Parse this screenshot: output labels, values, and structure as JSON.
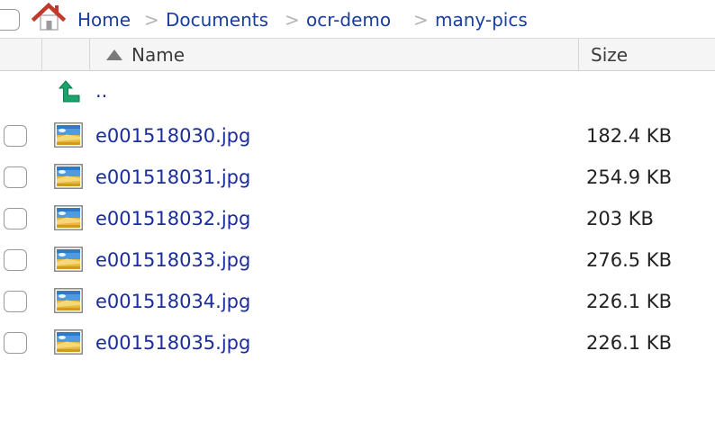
{
  "breadcrumb": {
    "items": [
      {
        "label": "Home",
        "icon": "home-icon"
      },
      {
        "label": "Documents"
      },
      {
        "label": "ocr-demo"
      },
      {
        "label": "many-pics"
      }
    ],
    "separator": ">"
  },
  "table": {
    "columns": {
      "name": {
        "label": "Name",
        "sort": "ascending",
        "sort_icon": "sort-ascending-icon"
      },
      "size": {
        "label": "Size"
      }
    },
    "parent_row": {
      "name": "..",
      "icon": "parent-directory-up-arrow-icon"
    },
    "rows": [
      {
        "name": "e001518030.jpg",
        "size": "182.4 KB",
        "icon": "image-file-icon"
      },
      {
        "name": "e001518031.jpg",
        "size": "254.9 KB",
        "icon": "image-file-icon"
      },
      {
        "name": "e001518032.jpg",
        "size": "203 KB",
        "icon": "image-file-icon"
      },
      {
        "name": "e001518033.jpg",
        "size": "276.5 KB",
        "icon": "image-file-icon"
      },
      {
        "name": "e001518034.jpg",
        "size": "226.1 KB",
        "icon": "image-file-icon"
      },
      {
        "name": "e001518035.jpg",
        "size": "226.1 KB",
        "icon": "image-file-icon"
      }
    ]
  },
  "colors": {
    "link": "#1a2d9a",
    "breadcrumb_link": "#1a3e9e",
    "header_background": "#f5f5f5",
    "home_roof": "#c0392b",
    "up_arrow": "#1aa36a"
  }
}
